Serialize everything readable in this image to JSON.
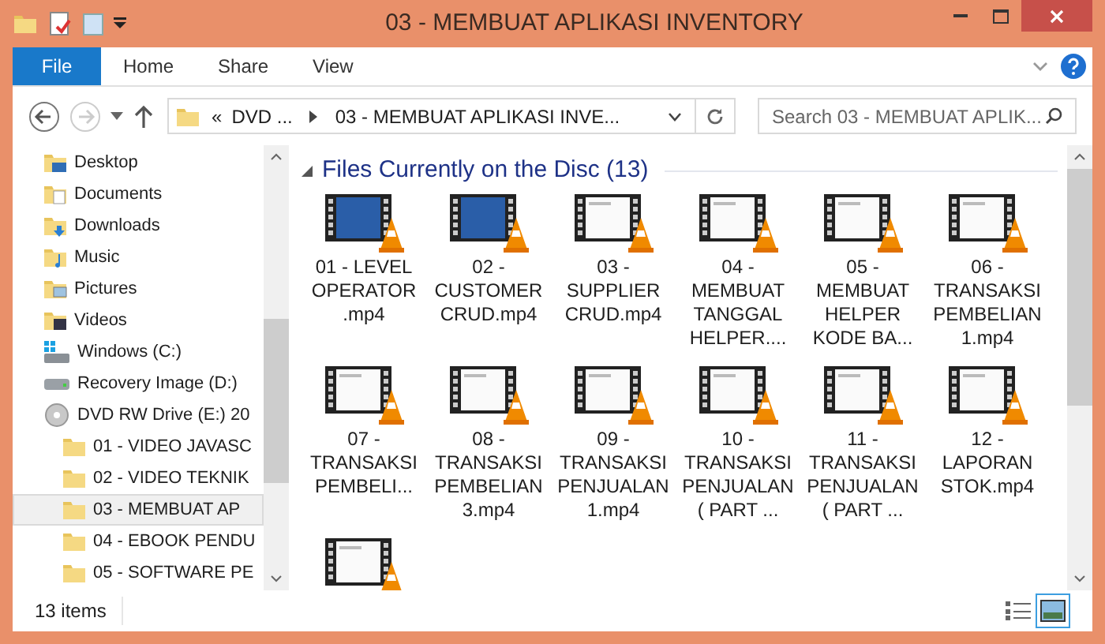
{
  "window": {
    "title": "03 - MEMBUAT APLIKASI INVENTORY"
  },
  "ribbon_tabs": [
    {
      "label": "File",
      "selected": true
    },
    {
      "label": "Home",
      "selected": false
    },
    {
      "label": "Share",
      "selected": false
    },
    {
      "label": "View",
      "selected": false
    }
  ],
  "address": {
    "overflow": "«",
    "segments": [
      "DVD ...",
      "03 - MEMBUAT APLIKASI INVE..."
    ]
  },
  "search": {
    "placeholder": "Search 03 - MEMBUAT APLIK..."
  },
  "nav": [
    {
      "label": "Desktop",
      "kind": "desktop",
      "selected": false
    },
    {
      "label": "Documents",
      "kind": "documents",
      "selected": false
    },
    {
      "label": "Downloads",
      "kind": "downloads",
      "selected": false
    },
    {
      "label": "Music",
      "kind": "music",
      "selected": false
    },
    {
      "label": "Pictures",
      "kind": "pictures",
      "selected": false
    },
    {
      "label": "Videos",
      "kind": "videos",
      "selected": false
    },
    {
      "label": "Windows (C:)",
      "kind": "system-drive",
      "selected": false
    },
    {
      "label": "Recovery Image (D:)",
      "kind": "drive",
      "selected": false
    },
    {
      "label": "DVD RW Drive (E:) 20",
      "kind": "disc",
      "selected": false,
      "children": [
        {
          "label": "01 - VIDEO JAVASC",
          "kind": "folder",
          "selected": false
        },
        {
          "label": "02 - VIDEO TEKNIK",
          "kind": "folder",
          "selected": false
        },
        {
          "label": "03 - MEMBUAT AP",
          "kind": "folder",
          "selected": true
        },
        {
          "label": "04 - EBOOK PENDU",
          "kind": "folder",
          "selected": false
        },
        {
          "label": "05 - SOFTWARE PE",
          "kind": "folder",
          "selected": false
        }
      ]
    }
  ],
  "group": {
    "title": "Files Currently on the Disc (13)",
    "expanded": true
  },
  "files": [
    {
      "name": "01 - LEVEL OPERATOR .mp4",
      "kind": "slide"
    },
    {
      "name": "02 - CUSTOMER CRUD.mp4",
      "kind": "slide"
    },
    {
      "name": "03 - SUPPLIER CRUD.mp4",
      "kind": "screen"
    },
    {
      "name": "04 - MEMBUAT TANGGAL HELPER....",
      "kind": "screen"
    },
    {
      "name": "05 - MEMBUAT HELPER KODE BA...",
      "kind": "screen"
    },
    {
      "name": "06 - TRANSAKSI PEMBELIAN 1.mp4",
      "kind": "screen"
    },
    {
      "name": "07 -TRANSAKSI PEMBELI...",
      "kind": "screen"
    },
    {
      "name": "08 - TRANSAKSI PEMBELIAN 3.mp4",
      "kind": "screen"
    },
    {
      "name": "09 - TRANSAKSI PENJUALAN 1.mp4",
      "kind": "screen"
    },
    {
      "name": "10 - TRANSAKSI PENJUALAN ( PART ...",
      "kind": "screen"
    },
    {
      "name": "11 - TRANSAKSI PENJUALAN ( PART ...",
      "kind": "screen"
    },
    {
      "name": "12 - LAPORAN STOK.mp4",
      "kind": "screen"
    },
    {
      "kind": "screen"
    }
  ],
  "status_bar": {
    "count": "13 items"
  },
  "view_buttons": [
    {
      "kind": "details",
      "selected": false
    },
    {
      "kind": "large-icons",
      "selected": true
    }
  ]
}
